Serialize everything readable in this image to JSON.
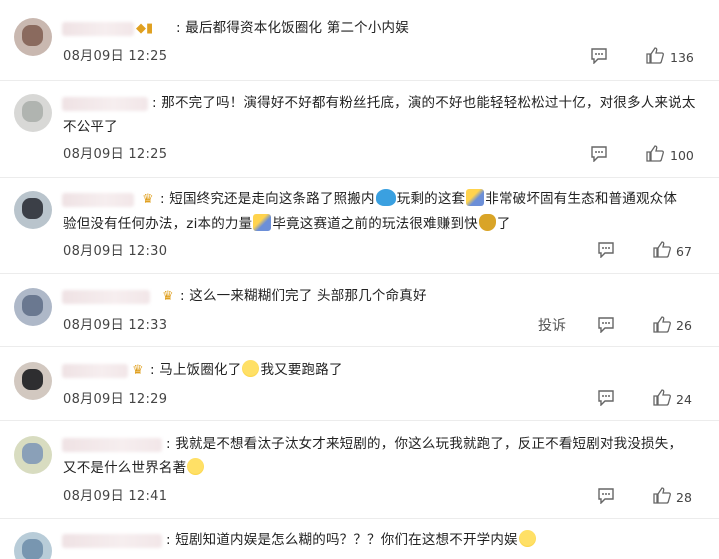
{
  "comments": [
    {
      "text": "最后都得资本化饭圈化 第二个小内娱",
      "date": "08月09日",
      "time": "12:25",
      "likes": "136"
    },
    {
      "text_line1": "那不完了吗！演得好不好都有粉丝托底，演的不好也能轻轻松松过十亿，对很多人来说太",
      "text_line2": "不公平了",
      "date": "08月09日",
      "time": "12:25",
      "likes": "100"
    },
    {
      "text_line1_a": "短国终究还是走向这条路了照搬内",
      "text_line1_b": "玩剩的这套",
      "text_line1_c": "非常破坏固有生态和普通观众体",
      "text_line2_a": "验但没有任何办法，zi本的力量",
      "text_line2_b": "毕竟这赛道之前的玩法很难赚到快",
      "text_line2_c": "了",
      "date": "08月09日",
      "time": "12:30",
      "likes": "67"
    },
    {
      "text": "这么一来糊糊们完了 头部那几个命真好",
      "date": "08月09日",
      "time": "12:33",
      "report": "投诉",
      "likes": "26"
    },
    {
      "text_a": "马上饭圈化了",
      "text_b": "我又要跑路了",
      "date": "08月09日",
      "time": "12:29",
      "likes": "24"
    },
    {
      "text_line1": "我就是不想看汰子汰女才来短剧的，你这么玩我就跑了，反正不看短剧对我没损失，",
      "text_line2": "又不是什么世界名著",
      "date": "08月09日",
      "time": "12:41",
      "likes": "28"
    },
    {
      "text": "短剧知道内娱是怎么糊的吗？？？你们在这想不开学内娱"
    }
  ],
  "icons": {
    "comment": "comment-icon",
    "like": "thumbs-up-icon",
    "emoji_laugh": "laughing-emoji-icon",
    "emoji_smirk": "smirk-emoji-icon",
    "emoji_wave": "wave-emoji-icon",
    "emoji_wand": "magic-wand-emoji-icon",
    "emoji_bag": "money-bag-emoji-icon"
  }
}
